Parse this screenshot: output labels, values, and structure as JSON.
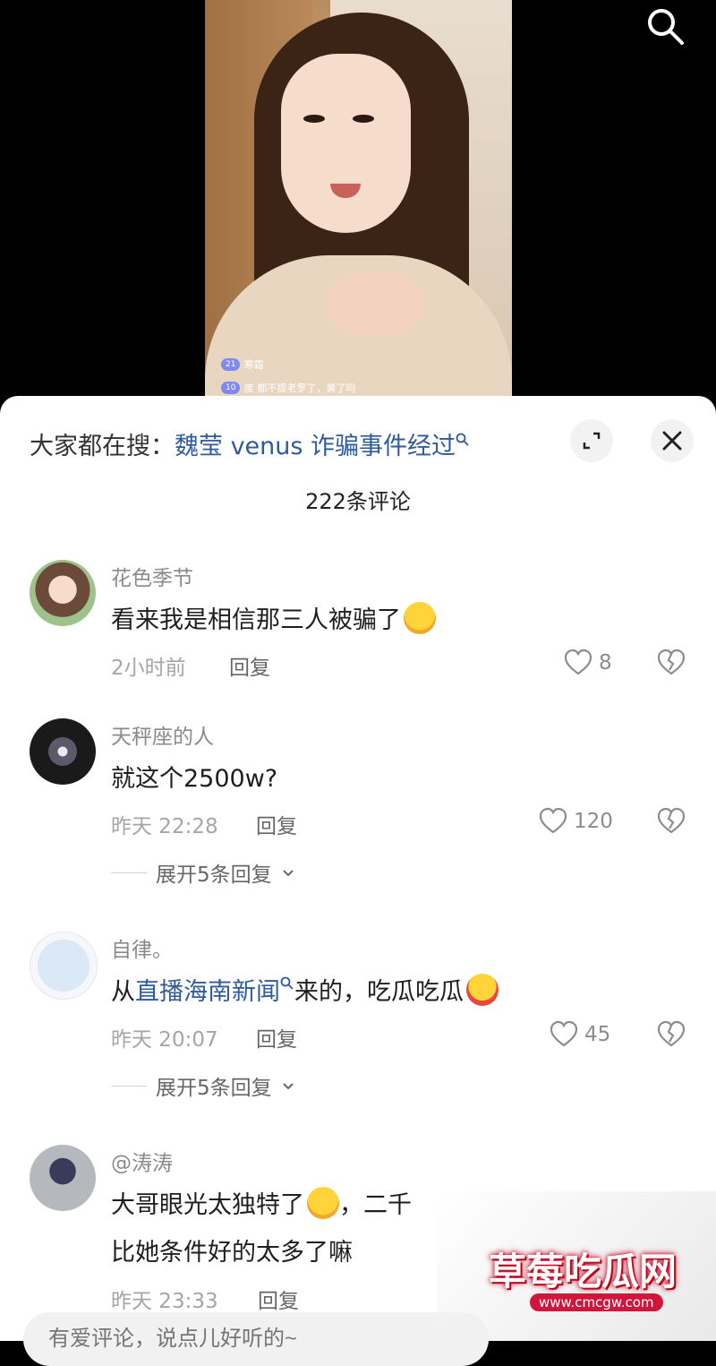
{
  "live": {
    "badge_level": "21",
    "badge_name": "寒霜",
    "line2_badge": "10",
    "line2_user": "度",
    "line2_text": "都不提老罗了，黄了吗"
  },
  "sheet": {
    "hot_prefix": "大家都在搜：",
    "hot_keyword": "魏莹 venus 诈骗事件经过",
    "comment_count": "222条评论"
  },
  "comments": [
    {
      "user": "花色季节",
      "text": "看来我是相信那三人被骗了",
      "time": "2小时前",
      "reply": "回复",
      "likes": "8"
    },
    {
      "user": "天秤座的人",
      "text": "就这个2500w?",
      "time": "昨天 22:28",
      "reply": "回复",
      "likes": "120",
      "expand": "展开5条回复"
    },
    {
      "user": "自律。",
      "text_pre": "从",
      "text_link": "直播海南新闻",
      "text_post": "来的，吃瓜吃瓜",
      "time": "昨天 20:07",
      "reply": "回复",
      "likes": "45",
      "expand": "展开5条回复"
    },
    {
      "user": "@涛涛",
      "text_line1": "大哥眼光太独特了",
      "text_line1_tail": "，二千",
      "text_line2": "比她条件好的太多了嘛",
      "time": "昨天 23:33",
      "reply": "回复"
    }
  ],
  "input": {
    "placeholder": "有爱评论，说点儿好听的~"
  },
  "watermark": {
    "title": "草莓吃瓜网",
    "url": "www.cmcgw.com"
  },
  "colors": {
    "link": "#2f5b9c",
    "text": "#1e1e1e",
    "meta": "#a5a5a5"
  }
}
